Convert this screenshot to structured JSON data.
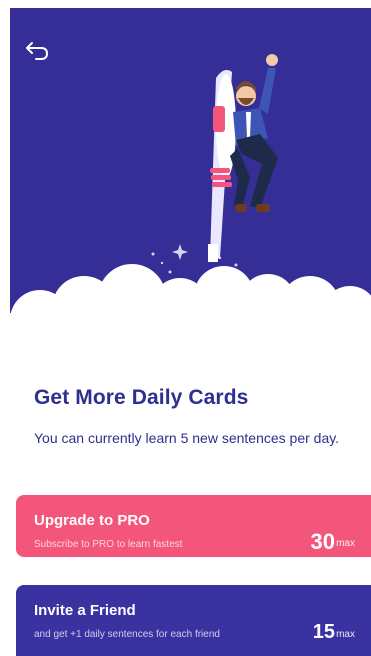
{
  "hero": {
    "back_icon": "back-arrow-icon",
    "illustration": "rocket-man-illustration"
  },
  "main": {
    "title": "Get More Daily Cards",
    "subtitle": "You can currently learn 5 new sentences per day."
  },
  "cards": [
    {
      "title": "Upgrade to PRO",
      "subtitle": "Subscribe to PRO to learn fastest",
      "count": "30",
      "unit": "max",
      "color": "#f4557a"
    },
    {
      "title": "Invite a Friend",
      "subtitle": "and get +1 daily sentences for each friend",
      "count": "15",
      "unit": "max",
      "color": "#3a32a0"
    }
  ],
  "colors": {
    "hero_bg": "#342e96",
    "heading": "#2e2f8f"
  }
}
